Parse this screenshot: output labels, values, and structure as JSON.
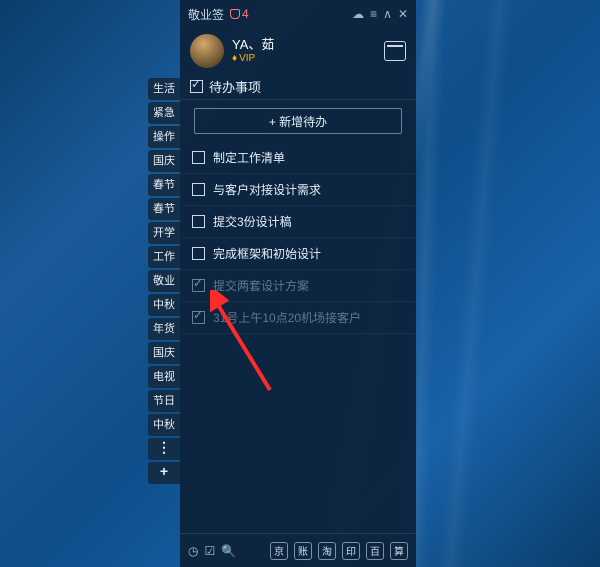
{
  "app_name": "敬业签",
  "notif_count": "4",
  "user": {
    "name": "YA、茹",
    "vip_label": "VIP"
  },
  "section_title": "待办事项",
  "add_button_label": "+ 新增待办",
  "todos": [
    {
      "text": "制定工作清单",
      "done": false
    },
    {
      "text": "与客户对接设计需求",
      "done": false
    },
    {
      "text": "提交3份设计稿",
      "done": false
    },
    {
      "text": "完成框架和初始设计",
      "done": false
    },
    {
      "text": "提交两套设计方案",
      "done": true
    },
    {
      "text": "31号上午10点20机场接客户",
      "done": true
    }
  ],
  "tags": [
    "生活",
    "紧急",
    "操作",
    "国庆",
    "春节",
    "春节",
    "开学",
    "工作",
    "敬业",
    "中秋",
    "年货",
    "国庆",
    "电视",
    "节日",
    "中秋"
  ],
  "bottom_icons_left": [
    "clock-icon",
    "checkbox-icon",
    "search-icon"
  ],
  "bottom_icons_right_labels": [
    "京",
    "账",
    "淘",
    "印",
    "百",
    "算"
  ],
  "title_icons": [
    "cloud-icon",
    "menu-icon",
    "caret-icon",
    "close-icon"
  ]
}
